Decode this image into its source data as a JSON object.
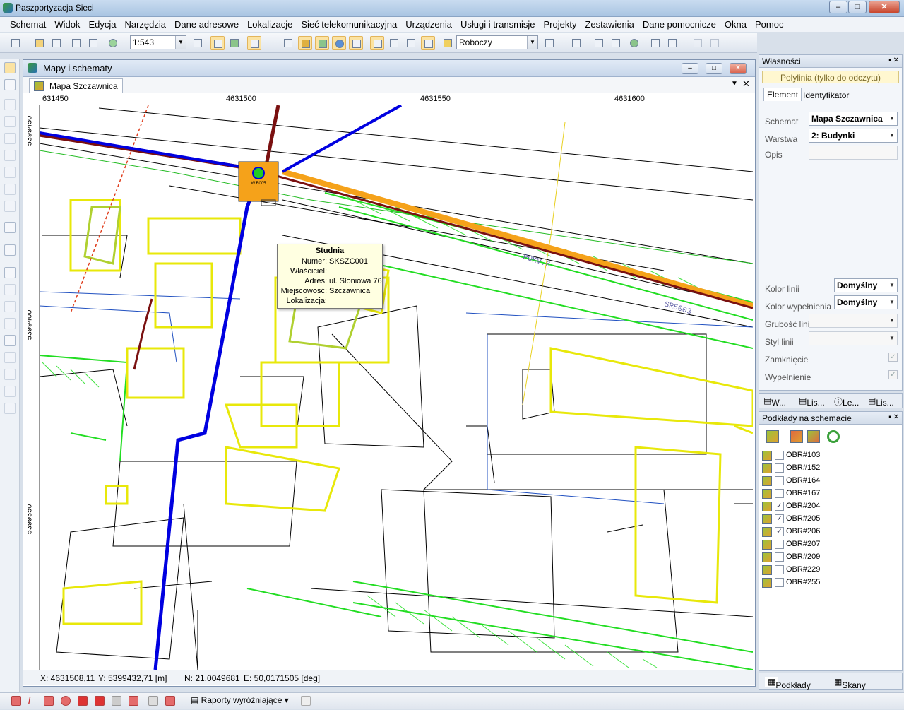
{
  "app": {
    "title": "Paszportyzacja Sieci"
  },
  "menu": [
    "Schemat",
    "Widok",
    "Edycja",
    "Narzędzia",
    "Dane adresowe",
    "Lokalizacje",
    "Sieć telekomunikacyjna",
    "Urządzenia",
    "Usługi i transmisje",
    "Projekty",
    "Zestawienia",
    "Dane pomocnicze",
    "Okna",
    "Pomoc"
  ],
  "toolbar": {
    "scale": "1:543",
    "mode": "Roboczy"
  },
  "mdi": {
    "title": "Mapy i schematy",
    "tab": "Mapa Szczawnica"
  },
  "map": {
    "ruler_x": [
      "631450",
      "4631500",
      "4631550",
      "4631600"
    ],
    "ruler_y": [
      "5399450",
      "5399400",
      "5399350"
    ],
    "well_label": "W.B005",
    "colors": {
      "duct_blue": "#0000e0",
      "cable_red": "#7a1010",
      "cable_orange": "#f5a21a",
      "building_yellow": "#e8e80a",
      "terrain_green": "#22dd22"
    }
  },
  "tooltip": {
    "title": "Studnia",
    "rows": [
      {
        "k": "Numer:",
        "v": "SKSZC001"
      },
      {
        "k": "Właściciel:",
        "v": ""
      },
      {
        "k": "Adres:",
        "v": "ul. Słoniowa 76"
      },
      {
        "k": "Miejscowość:",
        "v": "Szczawnica"
      },
      {
        "k": "Lokalizacja:",
        "v": ""
      }
    ]
  },
  "status": {
    "x": "X: 4631508,11",
    "y": "Y: 5399432,71 [m]",
    "n": "N: 21,0049681",
    "e": "E: 50,0171505 [deg]"
  },
  "props": {
    "header": "Własności",
    "subtitle": "Polylinia (tylko do odczytu)",
    "tab_element": "Element",
    "tab_ident": "Identyfikator",
    "schemat_label": "Schemat",
    "schemat_value": "Mapa Szczawnica",
    "warstwa_label": "Warstwa",
    "warstwa_value": "2: Budynki",
    "opis_label": "Opis",
    "kolor_linii_label": "Kolor linii",
    "kolor_linii_value": "Domyślny",
    "kolor_wyp_label": "Kolor wypełnienia",
    "kolor_wyp_value": "Domyślny",
    "grubosc_label": "Grubość linii",
    "styl_label": "Styl linii",
    "zamkniecie_label": "Zamknięcie",
    "wypelnienie_label": "Wypełnienie"
  },
  "bottabs": [
    "W...",
    "Lis...",
    "Le...",
    "Lis..."
  ],
  "layers": {
    "header": "Podkłady na schemacie",
    "items": [
      {
        "name": "OBR#103",
        "checked": false
      },
      {
        "name": "OBR#152",
        "checked": false
      },
      {
        "name": "OBR#164",
        "checked": false
      },
      {
        "name": "OBR#167",
        "checked": false
      },
      {
        "name": "OBR#204",
        "checked": true
      },
      {
        "name": "OBR#205",
        "checked": true
      },
      {
        "name": "OBR#206",
        "checked": true
      },
      {
        "name": "OBR#207",
        "checked": false
      },
      {
        "name": "OBR#209",
        "checked": false
      },
      {
        "name": "OBR#229",
        "checked": false
      },
      {
        "name": "OBR#255",
        "checked": false
      }
    ],
    "tab1": "Podkłady na...",
    "tab2": "Skany na sc..."
  },
  "bottom": {
    "reports": "Raporty wyróżniające"
  }
}
